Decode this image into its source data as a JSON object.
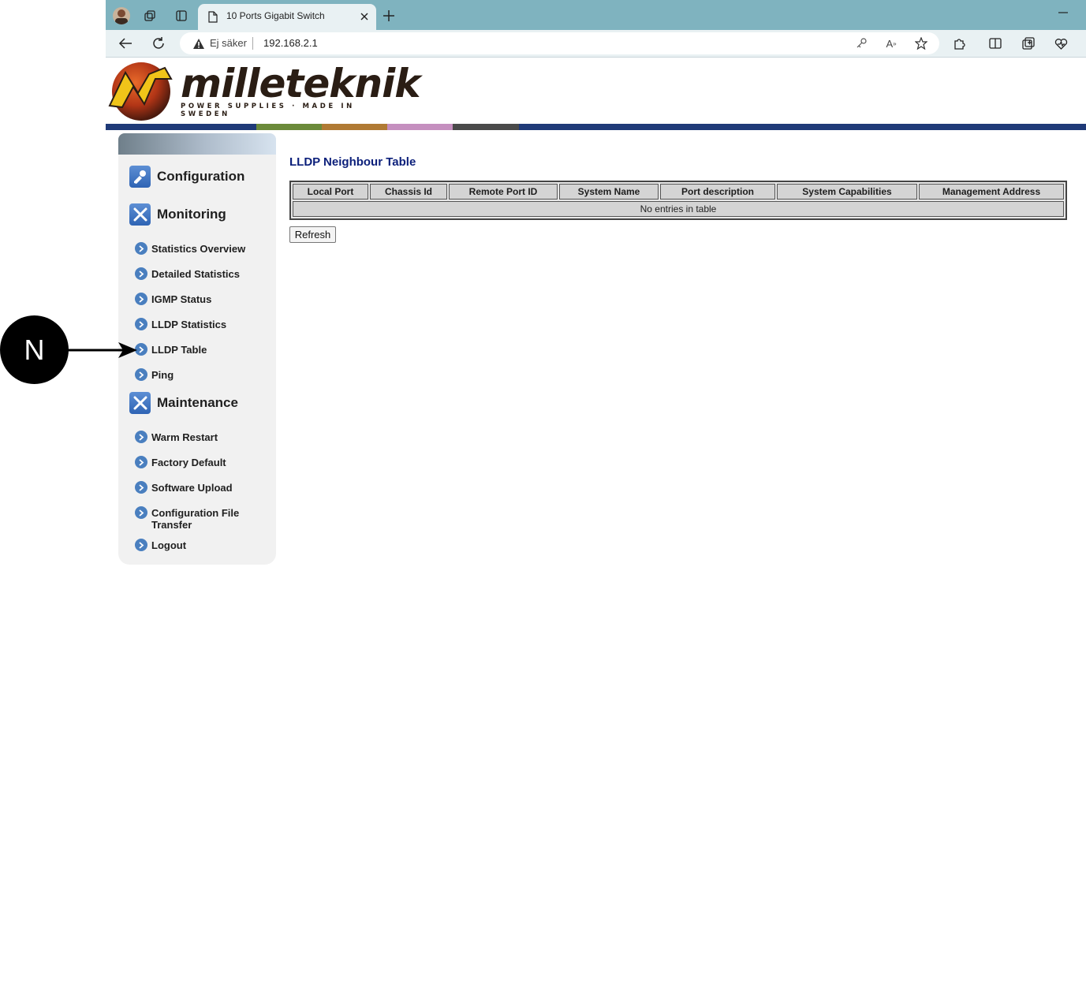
{
  "browser": {
    "tab_title": "10 Ports Gigabit Switch",
    "address_warning": "Ej säker",
    "address_url": "192.168.2.1",
    "icons": [
      "profile-avatar-icon",
      "collections-icon",
      "tab-actions-icon",
      "page-icon",
      "close-tab-icon",
      "new-tab-icon",
      "minimize-icon",
      "back-icon",
      "refresh-icon",
      "warning-icon",
      "key-icon",
      "read-aloud-icon",
      "favorite-star-icon",
      "extensions-icon",
      "split-screen-icon",
      "collections-icon",
      "browser-essentials-icon"
    ]
  },
  "logo": {
    "word": "milleteknik",
    "tagline": "POWER SUPPLIES · MADE IN SWEDEN"
  },
  "stripe_colors": [
    "#1f3a78",
    "#6b8a3a",
    "#b07a34",
    "#c58fbf",
    "#4a4a4a",
    "#1f3a78"
  ],
  "sidebar": {
    "sections": [
      {
        "label": "Configuration",
        "icon": "configuration-icon"
      },
      {
        "label": "Monitoring",
        "icon": "tools-icon"
      },
      {
        "label": "Maintenance",
        "icon": "tools-icon"
      }
    ],
    "monitoring_items": [
      {
        "label": "Statistics Overview"
      },
      {
        "label": "Detailed Statistics"
      },
      {
        "label": "IGMP Status"
      },
      {
        "label": "LLDP Statistics"
      },
      {
        "label": "LLDP Table"
      },
      {
        "label": "Ping"
      }
    ],
    "maintenance_items": [
      {
        "label": "Warm Restart"
      },
      {
        "label": "Factory Default"
      },
      {
        "label": "Software Upload"
      },
      {
        "label": "Configuration File Transfer"
      },
      {
        "label": "Logout"
      }
    ]
  },
  "main": {
    "title": "LLDP Neighbour Table",
    "columns": [
      "Local Port",
      "Chassis Id",
      "Remote Port ID",
      "System Name",
      "Port description",
      "System Capabilities",
      "Management Address"
    ],
    "empty_message": "No entries in table",
    "refresh_label": "Refresh"
  },
  "callout": {
    "letter": "N"
  }
}
